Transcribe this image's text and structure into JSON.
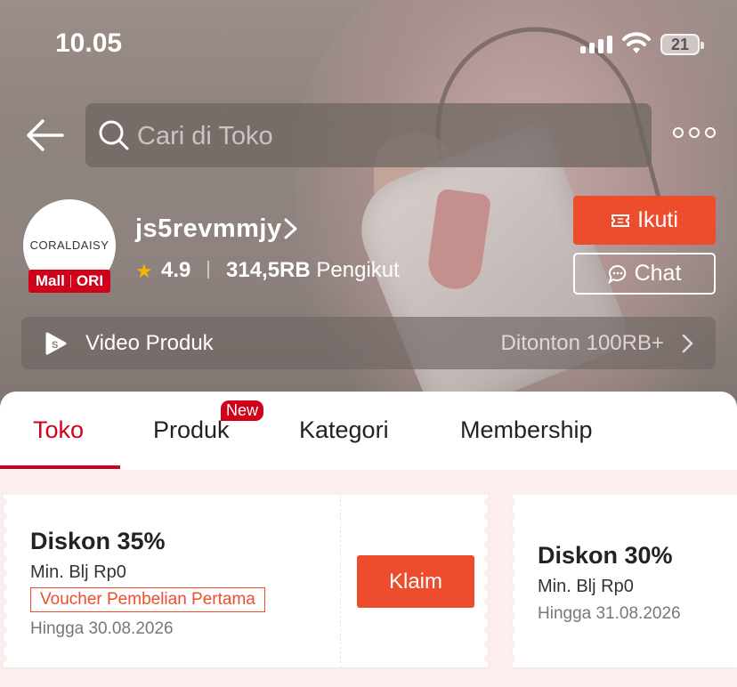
{
  "status_bar": {
    "time": "10.05",
    "battery": "21"
  },
  "search": {
    "placeholder": "Cari di Toko"
  },
  "shop": {
    "logo_text": "CORALDAISY",
    "badge_mall": "Mall",
    "badge_ori": "ORI",
    "name": "js5revmmjy",
    "rating": "4.9",
    "followers": "314,5RB",
    "followers_label": "Pengikut"
  },
  "actions": {
    "follow_label": "Ikuti",
    "chat_label": "Chat"
  },
  "video": {
    "label": "Video Produk",
    "count": "Ditonton 100RB+"
  },
  "tabs": [
    {
      "label": "Toko",
      "active": true
    },
    {
      "label": "Produk",
      "badge": "New"
    },
    {
      "label": "Kategori"
    },
    {
      "label": "Membership"
    }
  ],
  "vouchers": [
    {
      "title": "Diskon 35%",
      "min": "Min. Blj Rp0",
      "tag": "Voucher Pembelian Pertama",
      "expiry": "Hingga 30.08.2026",
      "button": "Klaim"
    },
    {
      "title": "Diskon 30%",
      "min": "Min. Blj Rp0",
      "expiry": "Hingga 31.08.2026"
    }
  ],
  "colors": {
    "accent": "#ee4d2d",
    "mall_red": "#d0011b",
    "star": "#f5b400"
  }
}
